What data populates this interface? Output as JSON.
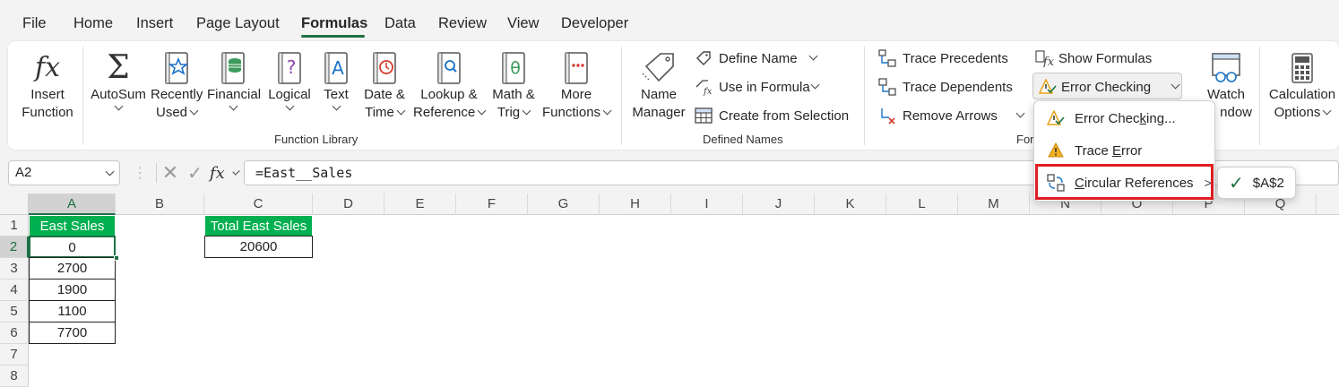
{
  "menu": {
    "items": [
      "File",
      "Home",
      "Insert",
      "Page Layout",
      "Formulas",
      "Data",
      "Review",
      "View",
      "Developer"
    ],
    "active": "Formulas"
  },
  "ribbon": {
    "insert_function": [
      "Insert",
      "Function"
    ],
    "library": {
      "autosum": "AutoSum",
      "recently_used": [
        "Recently",
        "Used"
      ],
      "financial": "Financial",
      "logical": "Logical",
      "text": "Text",
      "date_time": [
        "Date &",
        "Time"
      ],
      "lookup": [
        "Lookup &",
        "Reference"
      ],
      "math": [
        "Math &",
        "Trig"
      ],
      "more": [
        "More",
        "Functions"
      ],
      "group_label": "Function Library"
    },
    "names": {
      "name_manager": [
        "Name",
        "Manager"
      ],
      "define_name": "Define Name",
      "use_in_formula": "Use in Formula",
      "create_from_selection": "Create from Selection",
      "group_label": "Defined Names"
    },
    "auditing": {
      "trace_precedents": "Trace Precedents",
      "trace_dependents": "Trace Dependents",
      "remove_arrows": "Remove Arrows",
      "show_formulas": "Show Formulas",
      "error_checking": "Error Checking",
      "group_label_partial": "For"
    },
    "watch_window": [
      "Watch",
      "ndow"
    ],
    "calculation_options": [
      "Calculation",
      "Options"
    ]
  },
  "formula_bar": {
    "name_box": "A2",
    "formula": "=East__Sales"
  },
  "grid": {
    "columns": [
      "A",
      "B",
      "C",
      "D",
      "E",
      "F",
      "G",
      "H",
      "I",
      "J",
      "K",
      "L",
      "M",
      "N",
      "O",
      "P",
      "Q"
    ],
    "rows": [
      "1",
      "2",
      "3",
      "4",
      "5",
      "6",
      "7",
      "8"
    ],
    "selected_column": "A",
    "selected_row": "2",
    "cells": {
      "A1": "East Sales",
      "A2": "0",
      "A3": "2700",
      "A4": "1900",
      "A5": "1100",
      "A6": "7700",
      "C1": "Total East Sales",
      "C2": "20600"
    }
  },
  "error_menu": {
    "items": [
      {
        "label_pre": "Error Chec",
        "label_u": "k",
        "label_post": "ing..."
      },
      {
        "label_pre": "Trace ",
        "label_u": "E",
        "label_post": "rror"
      },
      {
        "label_pre": "",
        "label_u": "C",
        "label_post": "ircular References"
      }
    ],
    "submenu_item": "$A$2"
  },
  "colors": {
    "accent": "#1e7145",
    "header_fill": "#00b050",
    "highlight": "#e01e24"
  }
}
